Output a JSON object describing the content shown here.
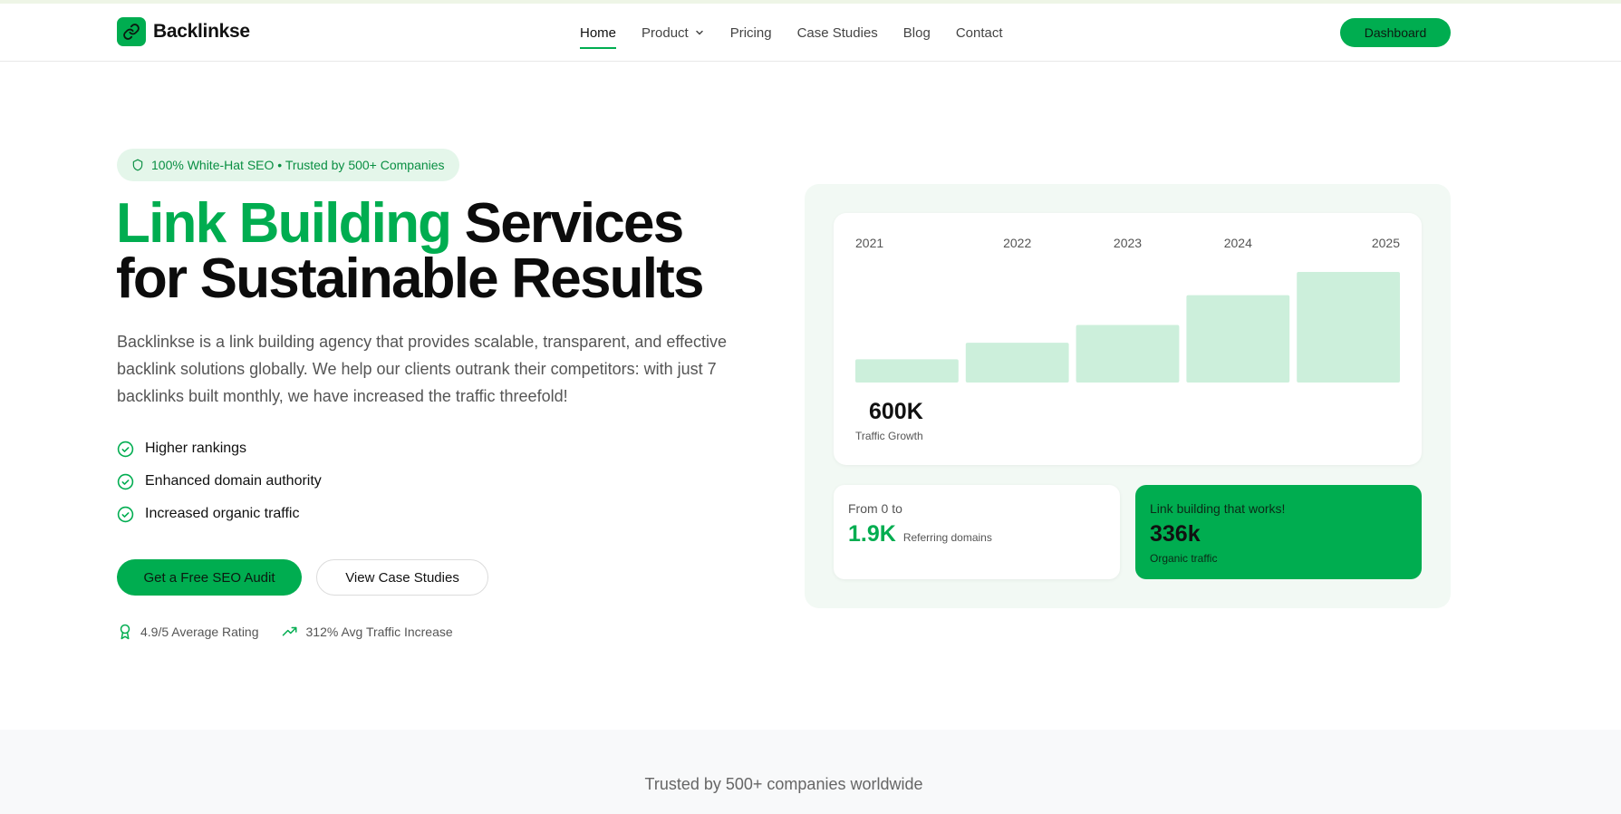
{
  "brand": {
    "name": "Backlinkse",
    "color": "#00ad50"
  },
  "nav": {
    "items": [
      {
        "label": "Home",
        "active": true
      },
      {
        "label": "Product",
        "has_dropdown": true
      },
      {
        "label": "Pricing"
      },
      {
        "label": "Case Studies"
      },
      {
        "label": "Blog"
      },
      {
        "label": "Contact"
      }
    ],
    "dashboard_label": "Dashboard"
  },
  "hero": {
    "badge": "100% White-Hat SEO • Trusted by 500+ Companies",
    "headline_green": "Link Building",
    "headline_rest_1": "Services",
    "headline_rest_2": "for Sustainable Results",
    "lead": "Backlinkse is a link building agency that provides scalable, transparent, and effective backlink solutions globally. We help our clients outrank their competitors: with just 7 backlinks built monthly, we have increased the traffic threefold!",
    "features": [
      "Higher rankings",
      "Enhanced domain authority",
      "Increased organic traffic"
    ],
    "cta_primary": "Get a Free SEO Audit",
    "cta_secondary": "View Case Studies",
    "stats": [
      {
        "icon": "award-icon",
        "text": "4.9/5 Average Rating"
      },
      {
        "icon": "trending-up-icon",
        "text": "312% Avg Traffic Increase"
      }
    ]
  },
  "stats_panel": {
    "growth_value": "600K",
    "growth_label": "Traffic Growth",
    "domains_prefix": "From 0 to",
    "domains_value": "1.9K",
    "domains_label": "Referring domains",
    "organic_tagline": "Link building that works!",
    "organic_value": "336k",
    "organic_label": "Organic traffic"
  },
  "chart_data": {
    "type": "bar",
    "categories": [
      "2021",
      "2022",
      "2023",
      "2024",
      "2025"
    ],
    "values": [
      0.21,
      0.36,
      0.52,
      0.79,
      1.0
    ],
    "ylim": [
      0,
      1
    ],
    "bar_color": "#ccefdb",
    "grid": false,
    "axis_labels_position": "top"
  },
  "trusted": {
    "text": "Trusted by 500+ companies worldwide"
  }
}
